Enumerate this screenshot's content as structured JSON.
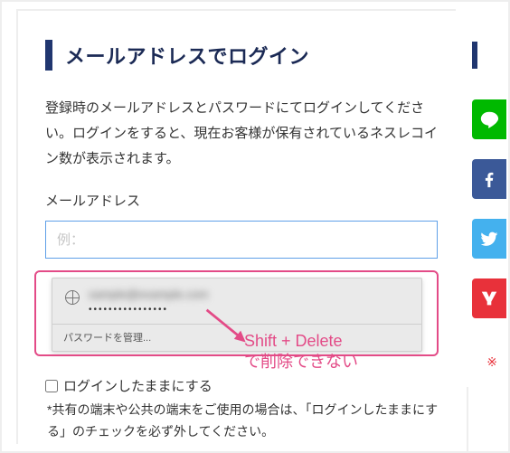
{
  "heading": "メールアドレスでログイン",
  "description": "登録時のメールアドレスとパスワードにてログインしてください。ログインをすると、現在お客様が保有されているネスレコイン数が表示されます。",
  "email": {
    "label": "メールアドレス",
    "placeholder": "例：",
    "value": ""
  },
  "autofill": {
    "email_masked": "sample@example.com",
    "password_dots": "••••••••••••••••",
    "manage_label": "パスワードを管理..."
  },
  "annotation": {
    "line1": "Shift + Delete",
    "line2": "で削除できない"
  },
  "stay_logged_in": {
    "checked": false,
    "label": "ログインしたままにする"
  },
  "hint": "*共有の端末や公共の端末をご使用の場合は、「ログインしたままにする」のチェックを必ず外してください。",
  "aside_mark": "※",
  "social": {
    "line": "line",
    "facebook": "facebook",
    "twitter": "twitter",
    "yahoo": "yahoo"
  },
  "colors": {
    "accent": "#20366f",
    "highlight": "#e34b87"
  }
}
